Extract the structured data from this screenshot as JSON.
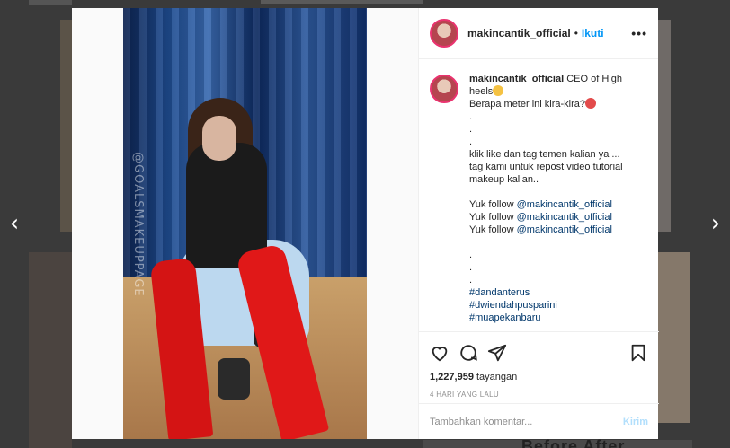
{
  "post": {
    "username": "makincantik_official",
    "follow_label": "Ikuti",
    "more_label": "•••",
    "watermark": "@GOALSMAKEUPPAGE",
    "caption_lines": [
      "CEO of High heels",
      "Berapa meter ini kira-kira?",
      ".",
      ".",
      ".",
      "klik like dan tag temen kalian ya ...",
      "tag kami untuk repost video tutorial",
      "makeup kalian..",
      "",
      "Yuk follow ",
      "Yuk follow ",
      "Yuk follow ",
      "",
      ".",
      ".",
      ".",
      "#dandanterus",
      "#dwiendahpusparini",
      "#muapekanbaru"
    ],
    "mention": "@makincantik_official",
    "views_count": "1,227,959",
    "views_label": "tayangan",
    "timestamp": "4 HARI YANG LALU",
    "comment_placeholder": "Tambahkan komentar...",
    "post_button": "Kirim"
  },
  "background": {
    "partial_text": "Before   After"
  },
  "icons": [
    "heart-icon",
    "comment-icon",
    "share-icon",
    "bookmark-icon",
    "chevron-left-icon",
    "chevron-right-icon"
  ],
  "colors": {
    "link_blue": "#0095f6",
    "tag_blue": "#00376b",
    "post_disabled": "#b2dffc"
  }
}
